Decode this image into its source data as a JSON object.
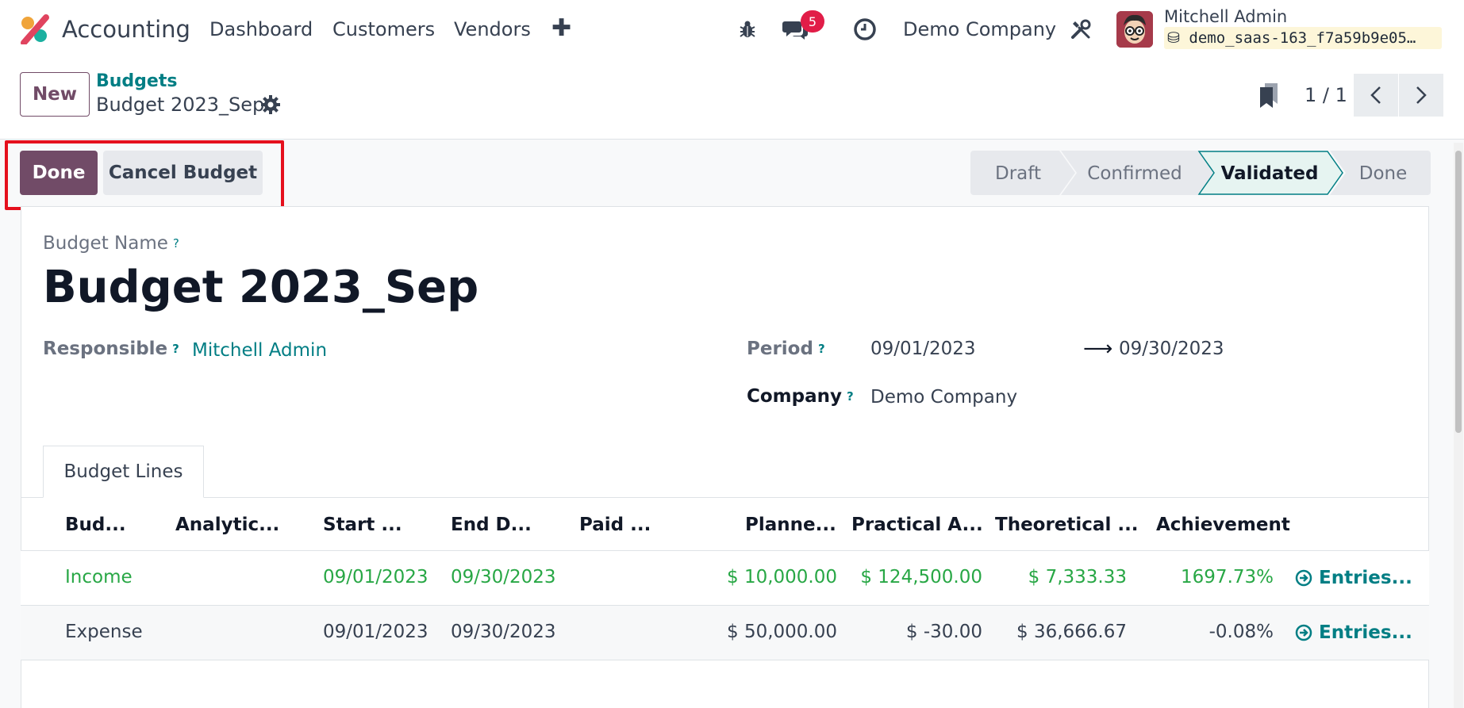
{
  "navbar": {
    "app_name": "Accounting",
    "menu": [
      "Dashboard",
      "Customers",
      "Vendors"
    ],
    "plus_icon": "plus-icon",
    "bug_icon": "bug-icon",
    "chat_icon": "chat-icon",
    "chat_badge": "5",
    "clock_icon": "clock-icon",
    "company": "Demo Company",
    "tools_icon": "tools-icon",
    "user_name": "Mitchell Admin",
    "database": "demo_saas-163_f7a59b9e05…"
  },
  "control_panel": {
    "new_label": "New",
    "breadcrumb_parent": "Budgets",
    "breadcrumb_current": "Budget 2023_Sep",
    "pager": "1 / 1"
  },
  "actions": {
    "done_label": "Done",
    "cancel_label": "Cancel Budget"
  },
  "statusbar": {
    "stages": [
      "Draft",
      "Confirmed",
      "Validated",
      "Done"
    ],
    "active": "Validated"
  },
  "form": {
    "name_label": "Budget Name",
    "name_value": "Budget 2023_Sep",
    "responsible_label": "Responsible",
    "responsible_value": "Mitchell Admin",
    "period_label": "Period",
    "period_start": "09/01/2023",
    "period_end": "09/30/2023",
    "company_label": "Company",
    "company_value": "Demo Company",
    "help_mark": "?"
  },
  "tabs": [
    "Budget Lines"
  ],
  "table": {
    "headers": [
      "Bud...",
      "Analytic...",
      "Start ...",
      "End D...",
      "Paid ...",
      "Planne...",
      "Practical A...",
      "Theoretical ...",
      "Achievement"
    ],
    "rows": [
      {
        "budget": "Income",
        "start": "09/01/2023",
        "end": "09/30/2023",
        "planned": "$ 10,000.00",
        "practical": "$ 124,500.00",
        "theoretical": "$ 7,333.33",
        "achievement": "1697.73%",
        "entries": "Entries..."
      },
      {
        "budget": "Expense",
        "start": "09/01/2023",
        "end": "09/30/2023",
        "planned": "$ 50,000.00",
        "practical": "$ -30.00",
        "theoretical": "$ 36,666.67",
        "achievement": "-0.08%",
        "entries": "Entries..."
      }
    ]
  },
  "colors": {
    "brand": "#714b67",
    "link": "#017e84",
    "positive": "#28a745",
    "highlight": "#e5101d"
  }
}
